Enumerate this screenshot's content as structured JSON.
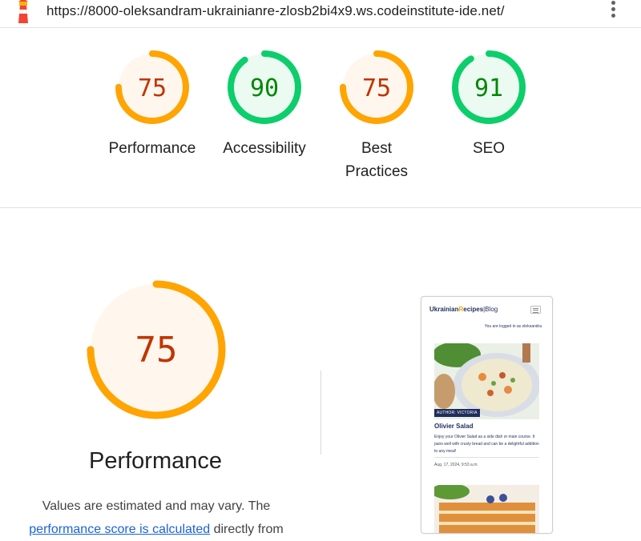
{
  "browser": {
    "url": "https://8000-oleksandram-ukrainianre-zlosb2bi4x9.ws.codeinstitute-ide.net/",
    "logo_icon": "lighthouse-icon",
    "menu_icon": "kebab-menu-icon"
  },
  "summary": {
    "gauges": [
      {
        "label": "Performance",
        "score": "75",
        "value": 0.75,
        "status": "average"
      },
      {
        "label": "Accessibility",
        "score": "90",
        "value": 0.9,
        "status": "pass"
      },
      {
        "label": "Best Practices",
        "score": "75",
        "value": 0.75,
        "status": "average"
      },
      {
        "label": "SEO",
        "score": "91",
        "value": 0.91,
        "status": "pass"
      }
    ]
  },
  "main": {
    "score": "75",
    "value": 0.75,
    "title": "Performance",
    "desc_prefix": "Values are estimated and may vary. The ",
    "desc_link": "performance score is calculated",
    "desc_suffix": " directly from"
  },
  "phone": {
    "brand_part1": "Ukrainian",
    "brand_r": "R",
    "brand_part2": "ecipes",
    "brand_sep": "|",
    "brand_blog": "Blog",
    "login_text": "You are logged in as oleksandra",
    "author_badge": "AUTHOR: VICTORIA",
    "post_title": "Olivier Salad",
    "post_text": "Enjoy your Olivier Salad as a side dish or main course. It pairs well with crusty bread and can be a delightful addition to any meal!",
    "post_date": "Aug. 17, 2024, 9:53 a.m."
  },
  "colors": {
    "average": "#ffa400",
    "average_bg": "#fff7ed",
    "average_text": "#c33300",
    "pass": "#0cce6b",
    "pass_bg": "#ecfbf2",
    "pass_text": "#008800",
    "link": "#1a63d6"
  }
}
